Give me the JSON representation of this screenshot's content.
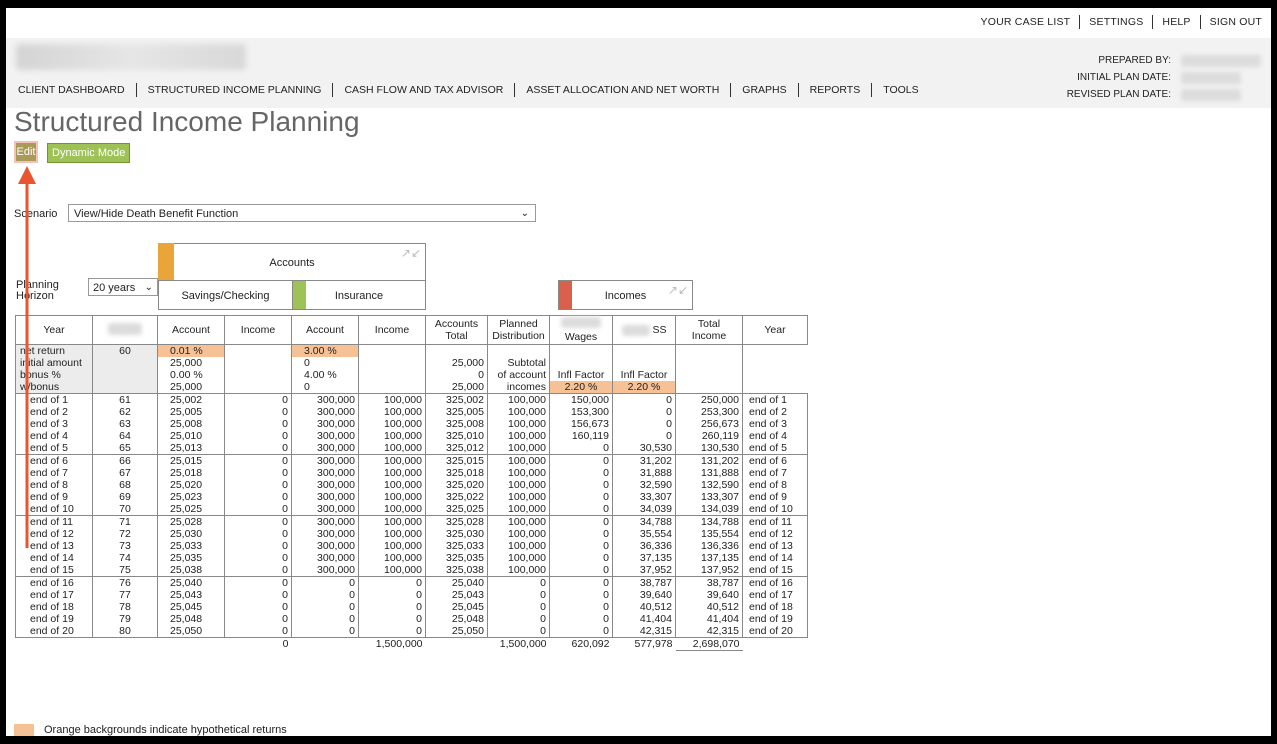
{
  "top_nav": [
    "YOUR CASE LIST",
    "SETTINGS",
    "HELP",
    "SIGN OUT"
  ],
  "header": {
    "prepared_by_label": "PREPARED BY:",
    "initial_plan_date_label": "INITIAL PLAN DATE:",
    "revised_plan_date_label": "REVISED PLAN DATE:"
  },
  "main_nav": [
    "CLIENT DASHBOARD",
    "STRUCTURED INCOME PLANNING",
    "CASH FLOW AND TAX ADVISOR",
    "ASSET ALLOCATION AND NET WORTH",
    "GRAPHS",
    "REPORTS",
    "TOOLS"
  ],
  "page_title": "Structured Income Planning",
  "buttons": {
    "edit": "Edit",
    "dynamic_mode": "Dynamic Mode"
  },
  "scenario": {
    "label": "Scenario",
    "value": "View/Hide Death Benefit Function"
  },
  "planning_horizon": {
    "label_line1": "Planning",
    "label_line2": "Horizon",
    "value": "20 years"
  },
  "groups": {
    "accounts": "Accounts",
    "savings_checking": "Savings/Checking",
    "insurance": "Insurance",
    "incomes": "Incomes"
  },
  "columns": {
    "year": "Year",
    "account": "Account",
    "income": "Income",
    "accounts_total_1": "Accounts",
    "accounts_total_2": "Total",
    "planned_1": "Planned",
    "planned_2": "Distribution",
    "wages": "Wages",
    "ss": "SS",
    "total_income_1": "Total",
    "total_income_2": "Income",
    "year_right": "Year"
  },
  "assumptions": [
    {
      "label": "net return",
      "age": "60",
      "sav_acc": "0.01 %",
      "sav_inc": "",
      "ins_acc": "3.00 %",
      "ins_inc": "",
      "tot": "",
      "pd": "",
      "wages": "",
      "ss": "",
      "ti": "",
      "y2": ""
    },
    {
      "label": "initial amount",
      "age": "",
      "sav_acc": "25,000",
      "sav_inc": "",
      "ins_acc": "0",
      "ins_inc": "",
      "tot": "25,000",
      "pd": "Subtotal",
      "wages": "",
      "ss": "",
      "ti": "",
      "y2": ""
    },
    {
      "label": "bonus %",
      "age": "",
      "sav_acc": "0.00 %",
      "sav_inc": "",
      "ins_acc": "4.00 %",
      "ins_inc": "",
      "tot": "0",
      "pd": "of account",
      "wages": "Infl Factor",
      "ss": "Infl Factor",
      "ti": "",
      "y2": ""
    },
    {
      "label": "w/bonus",
      "age": "",
      "sav_acc": "25,000",
      "sav_inc": "",
      "ins_acc": "0",
      "ins_inc": "",
      "tot": "25,000",
      "pd": "incomes",
      "wages": "2.20 %",
      "ss": "2.20 %",
      "ti": "",
      "y2": ""
    }
  ],
  "rows": [
    [
      "end of 1",
      "61",
      "25,002",
      "0",
      "300,000",
      "100,000",
      "325,002",
      "100,000",
      "150,000",
      "0",
      "250,000",
      "end of 1"
    ],
    [
      "end of 2",
      "62",
      "25,005",
      "0",
      "300,000",
      "100,000",
      "325,005",
      "100,000",
      "153,300",
      "0",
      "253,300",
      "end of 2"
    ],
    [
      "end of 3",
      "63",
      "25,008",
      "0",
      "300,000",
      "100,000",
      "325,008",
      "100,000",
      "156,673",
      "0",
      "256,673",
      "end of 3"
    ],
    [
      "end of 4",
      "64",
      "25,010",
      "0",
      "300,000",
      "100,000",
      "325,010",
      "100,000",
      "160,119",
      "0",
      "260,119",
      "end of 4"
    ],
    [
      "end of 5",
      "65",
      "25,013",
      "0",
      "300,000",
      "100,000",
      "325,012",
      "100,000",
      "0",
      "30,530",
      "130,530",
      "end of 5"
    ],
    [
      "end of 6",
      "66",
      "25,015",
      "0",
      "300,000",
      "100,000",
      "325,015",
      "100,000",
      "0",
      "31,202",
      "131,202",
      "end of 6"
    ],
    [
      "end of 7",
      "67",
      "25,018",
      "0",
      "300,000",
      "100,000",
      "325,018",
      "100,000",
      "0",
      "31,888",
      "131,888",
      "end of 7"
    ],
    [
      "end of 8",
      "68",
      "25,020",
      "0",
      "300,000",
      "100,000",
      "325,020",
      "100,000",
      "0",
      "32,590",
      "132,590",
      "end of 8"
    ],
    [
      "end of 9",
      "69",
      "25,023",
      "0",
      "300,000",
      "100,000",
      "325,022",
      "100,000",
      "0",
      "33,307",
      "133,307",
      "end of 9"
    ],
    [
      "end of 10",
      "70",
      "25,025",
      "0",
      "300,000",
      "100,000",
      "325,025",
      "100,000",
      "0",
      "34,039",
      "134,039",
      "end of 10"
    ],
    [
      "end of 11",
      "71",
      "25,028",
      "0",
      "300,000",
      "100,000",
      "325,028",
      "100,000",
      "0",
      "34,788",
      "134,788",
      "end of 11"
    ],
    [
      "end of 12",
      "72",
      "25,030",
      "0",
      "300,000",
      "100,000",
      "325,030",
      "100,000",
      "0",
      "35,554",
      "135,554",
      "end of 12"
    ],
    [
      "end of 13",
      "73",
      "25,033",
      "0",
      "300,000",
      "100,000",
      "325,033",
      "100,000",
      "0",
      "36,336",
      "136,336",
      "end of 13"
    ],
    [
      "end of 14",
      "74",
      "25,035",
      "0",
      "300,000",
      "100,000",
      "325,035",
      "100,000",
      "0",
      "37,135",
      "137,135",
      "end of 14"
    ],
    [
      "end of 15",
      "75",
      "25,038",
      "0",
      "300,000",
      "100,000",
      "325,038",
      "100,000",
      "0",
      "37,952",
      "137,952",
      "end of 15"
    ],
    [
      "end of 16",
      "76",
      "25,040",
      "0",
      "0",
      "0",
      "25,040",
      "0",
      "0",
      "38,787",
      "38,787",
      "end of 16"
    ],
    [
      "end of 17",
      "77",
      "25,043",
      "0",
      "0",
      "0",
      "25,043",
      "0",
      "0",
      "39,640",
      "39,640",
      "end of 17"
    ],
    [
      "end of 18",
      "78",
      "25,045",
      "0",
      "0",
      "0",
      "25,045",
      "0",
      "0",
      "40,512",
      "40,512",
      "end of 18"
    ],
    [
      "end of 19",
      "79",
      "25,048",
      "0",
      "0",
      "0",
      "25,048",
      "0",
      "0",
      "41,404",
      "41,404",
      "end of 19"
    ],
    [
      "end of 20",
      "80",
      "25,050",
      "0",
      "0",
      "0",
      "25,050",
      "0",
      "0",
      "42,315",
      "42,315",
      "end of 20"
    ]
  ],
  "totals": {
    "sav_inc": "0",
    "ins_inc": "1,500,000",
    "pd": "1,500,000",
    "wages": "620,092",
    "ss": "577,978",
    "ti": "2,698,070"
  },
  "legend": "Orange backgrounds indicate hypothetical returns",
  "colors": {
    "orange": "#f6c195",
    "savings": "#e9a43a",
    "insurance": "#9ec255",
    "incomes": "#d9614c",
    "edit_button": "#a89a58",
    "dynamic_button": "#9ec255",
    "annotation_arrow": "#e8552e"
  },
  "icons": {
    "collapse": "collapse-arrows-icon",
    "dropdown": "chevron-down-icon"
  }
}
